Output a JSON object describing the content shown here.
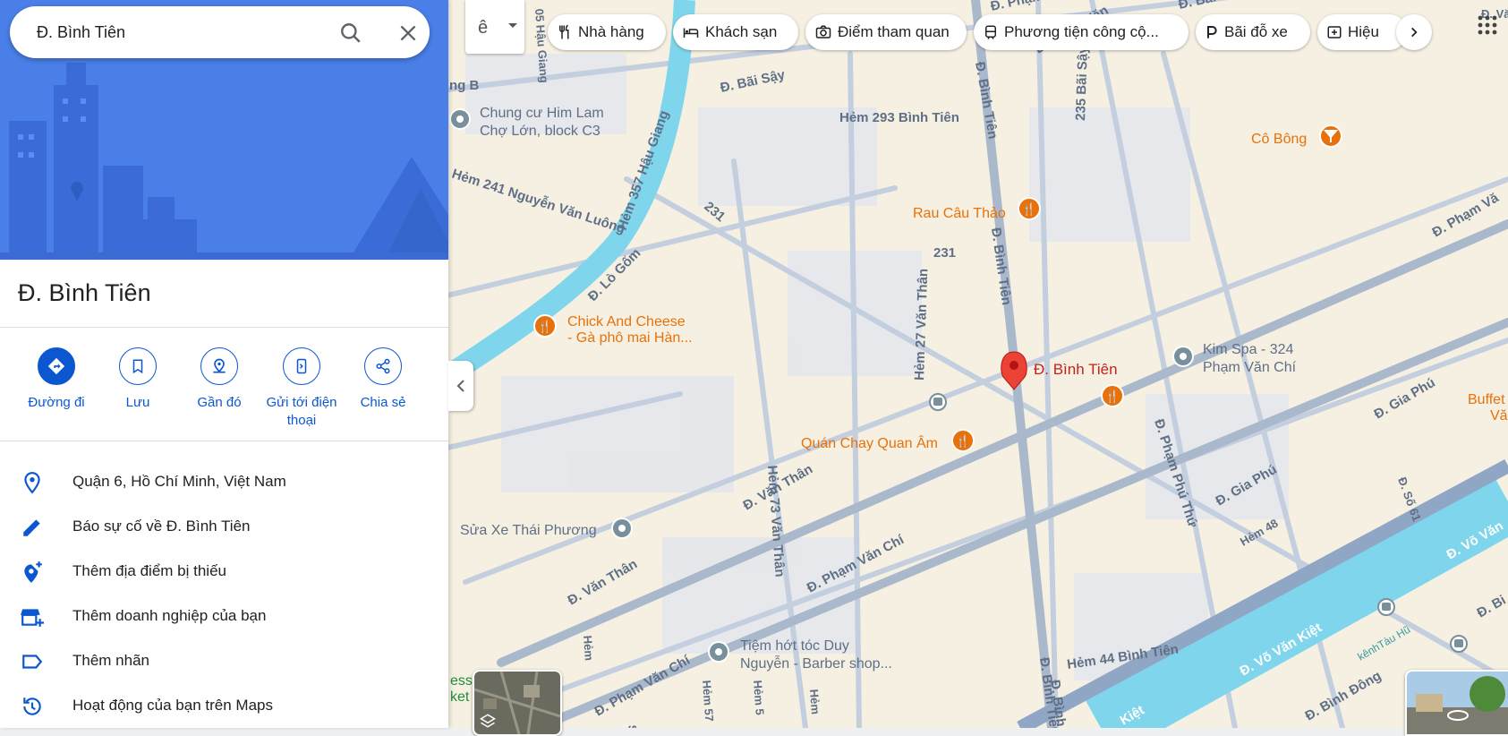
{
  "search": {
    "value": "Đ. Bình Tiên",
    "search_icon": "search-icon",
    "close_icon": "close-icon"
  },
  "place": {
    "title": "Đ. Bình Tiên"
  },
  "actions": [
    {
      "label": "Đường đi",
      "icon": "directions-icon"
    },
    {
      "label": "Lưu",
      "icon": "bookmark-icon"
    },
    {
      "label": "Gần đó",
      "icon": "nearby-icon"
    },
    {
      "label": "Gửi tới điện thoại",
      "icon": "send-to-phone-icon"
    },
    {
      "label": "Chia sẻ",
      "icon": "share-icon"
    }
  ],
  "details": [
    {
      "text": "Quận 6, Hồ Chí Minh, Việt Nam",
      "icon": "location-pin-icon"
    },
    {
      "text": "Báo sự cố về Đ. Bình Tiên",
      "icon": "pencil-icon"
    },
    {
      "text": "Thêm địa điểm bị thiếu",
      "icon": "add-location-icon"
    },
    {
      "text": "Thêm doanh nghiệp của bạn",
      "icon": "add-business-icon"
    },
    {
      "text": "Thêm nhãn",
      "icon": "label-icon"
    },
    {
      "text": "Hoạt động của bạn trên Maps",
      "icon": "history-icon"
    }
  ],
  "lang": {
    "label": "ê"
  },
  "chips": [
    {
      "label": "Nhà hàng",
      "icon": "restaurant-icon"
    },
    {
      "label": "Khách sạn",
      "icon": "hotel-icon"
    },
    {
      "label": "Điểm tham quan",
      "icon": "camera-icon"
    },
    {
      "label": "Phương tiện công cộ...",
      "icon": "transit-icon"
    },
    {
      "label": "Bãi đỗ xe",
      "icon": "parking-icon"
    },
    {
      "label": "Hiệu",
      "icon": "pharmacy-icon"
    }
  ],
  "map": {
    "streets": [
      {
        "label": "Đ. Bãi Sậy"
      },
      {
        "label": "Hẻm 293 Bình Tiên"
      },
      {
        "label": "Đ. Bình Tiên"
      },
      {
        "label": "Đ. Bình Tiên"
      },
      {
        "label": "Đ. Bình Tiên"
      },
      {
        "label": "235 Bãi Sậy"
      },
      {
        "label": "Hẻm 357 Hậu Giang"
      },
      {
        "label": "Hẻm 241 Nguyễn Văn Luông"
      },
      {
        "label": "Đ. Lò Gốm"
      },
      {
        "label": "231"
      },
      {
        "label": "231"
      },
      {
        "label": "Hẻm 27 Văn Thân"
      },
      {
        "label": "Hẻm 73 Văn Thân"
      },
      {
        "label": "Đ. Văn Thân"
      },
      {
        "label": "Đ. Văn Thân"
      },
      {
        "label": "Đ. Phạm Văn Chí"
      },
      {
        "label": "Đ. Phạm Văn Chí"
      },
      {
        "label": "Đ. Phạm Phú Thứ"
      },
      {
        "label": "Đ. Gia Phú"
      },
      {
        "label": "Đ. Gia Phú"
      },
      {
        "label": "Hẻm 48"
      },
      {
        "label": "Đ. Số 61"
      },
      {
        "label": "Hẻm 44 Bình Tiên"
      },
      {
        "label": "Đ. Võ Văn Kiệt"
      },
      {
        "label": "Đ. Võ Văn"
      },
      {
        "label": "Kiệt"
      },
      {
        "label": "Đ. Bình Đông"
      },
      {
        "label": "kênhTàu Hũ"
      },
      {
        "label": "Đ. Phạm Vă"
      },
      {
        "label": "Đ. Phạm Văn"
      },
      {
        "label": "05 Hậu Giang"
      },
      {
        "label": "Hẻm 57"
      },
      {
        "label": "Hẻm 5"
      },
      {
        "label": "Hẻm"
      },
      {
        "label": "Hẻm"
      },
      {
        "label": "Đ. Bình"
      },
      {
        "label": "Đ. Bi"
      },
      {
        "label": "Đ. Bãi Sậy"
      },
      {
        "label": "Đ. Phạm Văn"
      },
      {
        "label": "Đ. Văn Thân"
      },
      {
        "label": "ng B"
      },
      {
        "label": "Sơ"
      }
    ],
    "pois": [
      {
        "name": "Chung cư Him Lam Chợ Lớn, block C3",
        "line1": "Chung cư Him Lam",
        "line2": "Chợ Lớn, block C3",
        "kind": "gray"
      },
      {
        "name": "Cô Bông",
        "kind": "orange-bar"
      },
      {
        "name": "Rau Câu Thảo",
        "kind": "orange-food"
      },
      {
        "name": "Chick And Cheese - Gà phô mai Hàn...",
        "line1": "Chick And Cheese",
        "line2": "- Gà phô mai Hàn...",
        "kind": "orange-food"
      },
      {
        "name": "Kim Spa - 324 Phạm Văn Chí",
        "line1": "Kim Spa - 324",
        "line2": "Phạm Văn Chí",
        "kind": "gray"
      },
      {
        "name": "Quán Chay Quan Âm",
        "kind": "orange-food"
      },
      {
        "name": "Sửa Xe Thái Phương",
        "kind": "gray"
      },
      {
        "name": "Tiệm hớt tóc Duy Nguyễn - Barber shop...",
        "line1": "Tiệm hớt tóc Duy",
        "line2": "Nguyễn - Barber shop...",
        "kind": "gray"
      },
      {
        "name": "Buffet Văn",
        "line1": "Buffet",
        "line2": "Văn",
        "kind": "orange"
      },
      {
        "name": "ess ket",
        "line1": "ess",
        "line2": "ket",
        "kind": "green"
      }
    ],
    "selected": {
      "name": "Đ. Bình Tiên"
    },
    "colors": {
      "land": "#f5f0e1",
      "block": "#e4e7ec",
      "road": "#c3cede",
      "major_road": "#aab8cc",
      "canal": "#7fd6ec",
      "text": "#5f6f86",
      "poi_orange": "#e8710a",
      "pin_red": "#ea4335",
      "accent_blue": "#0b57d0"
    }
  }
}
